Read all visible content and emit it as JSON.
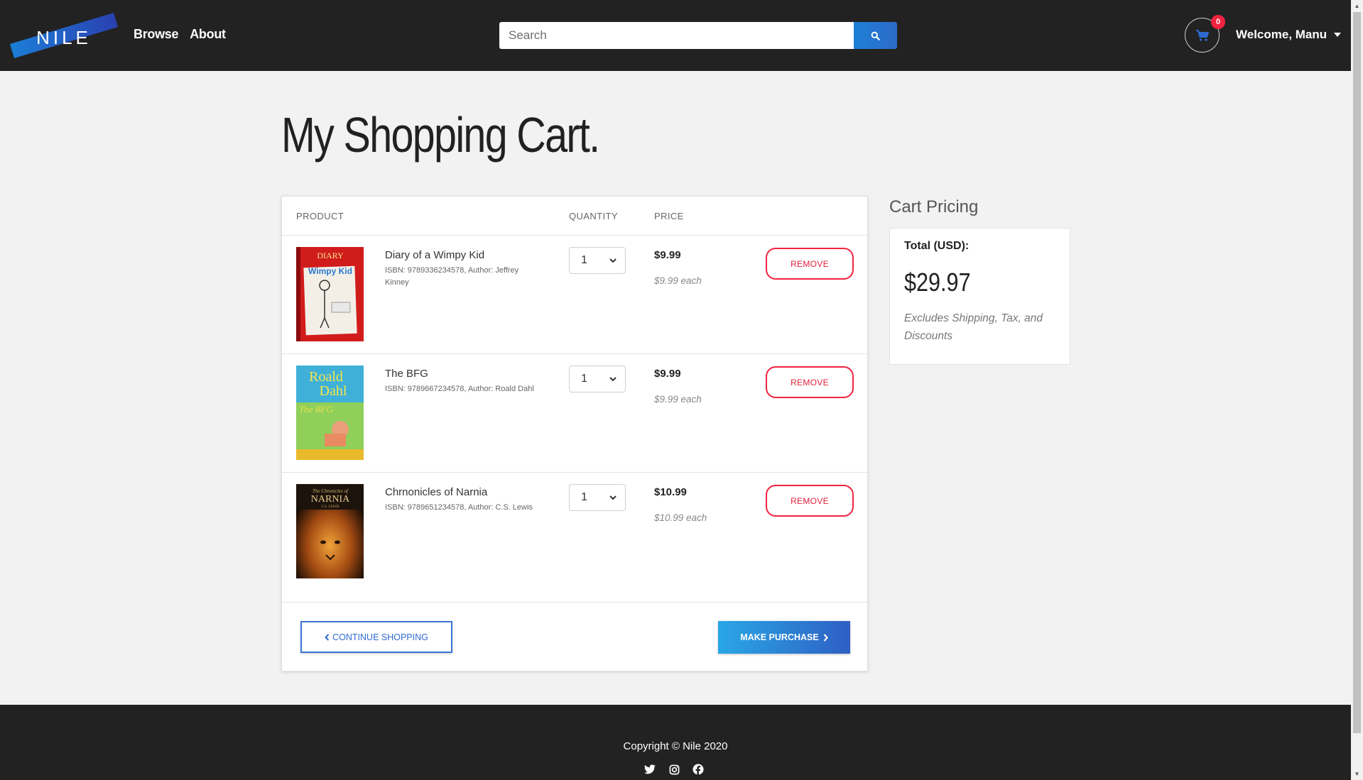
{
  "header": {
    "logo_text": "NILE",
    "nav": [
      {
        "label": "Browse"
      },
      {
        "label": "About"
      }
    ],
    "search_placeholder": "Search",
    "cart_count": "0",
    "welcome": "Welcome, Manu"
  },
  "page": {
    "title": "My Shopping Cart."
  },
  "cart": {
    "columns": {
      "product": "PRODUCT",
      "quantity": "QUANTITY",
      "price": "PRICE"
    },
    "items": [
      {
        "title": "Diary of a Wimpy Kid",
        "meta": "ISBN: 9789336234578, Author: Jeffrey Kinney",
        "quantity": "1",
        "price": "$9.99",
        "each": "$9.99 each",
        "remove": "REMOVE",
        "cover_text": "DIARY of a Wimpy Kid"
      },
      {
        "title": "The BFG",
        "meta": "ISBN: 9789667234578, Author: Roald Dahl",
        "quantity": "1",
        "price": "$9.99",
        "each": "$9.99 each",
        "remove": "REMOVE",
        "cover_text": "Roald Dahl The BFG"
      },
      {
        "title": "Chrnonicles of Narnia",
        "meta": "ISBN: 9789651234578, Author: C.S. Lewis",
        "quantity": "1",
        "price": "$10.99",
        "each": "$10.99 each",
        "remove": "REMOVE",
        "cover_text": "The Chronicles of NARNIA C.S. LEWIS"
      }
    ],
    "continue_label": "CONTINUE SHOPPING",
    "purchase_label": "MAKE PURCHASE"
  },
  "pricing": {
    "title": "Cart Pricing",
    "total_label": "Total (USD):",
    "total_value": "$29.97",
    "note": "Excludes Shipping, Tax, and Discounts"
  },
  "footer": {
    "copyright": "Copyright © Nile 2020",
    "social": [
      "twitter-icon",
      "instagram-icon",
      "facebook-icon"
    ]
  },
  "colors": {
    "navbar": "#222222",
    "accent_blue": "#2f6ad0",
    "remove_red": "#f0243f",
    "background": "#f2f2f2"
  }
}
